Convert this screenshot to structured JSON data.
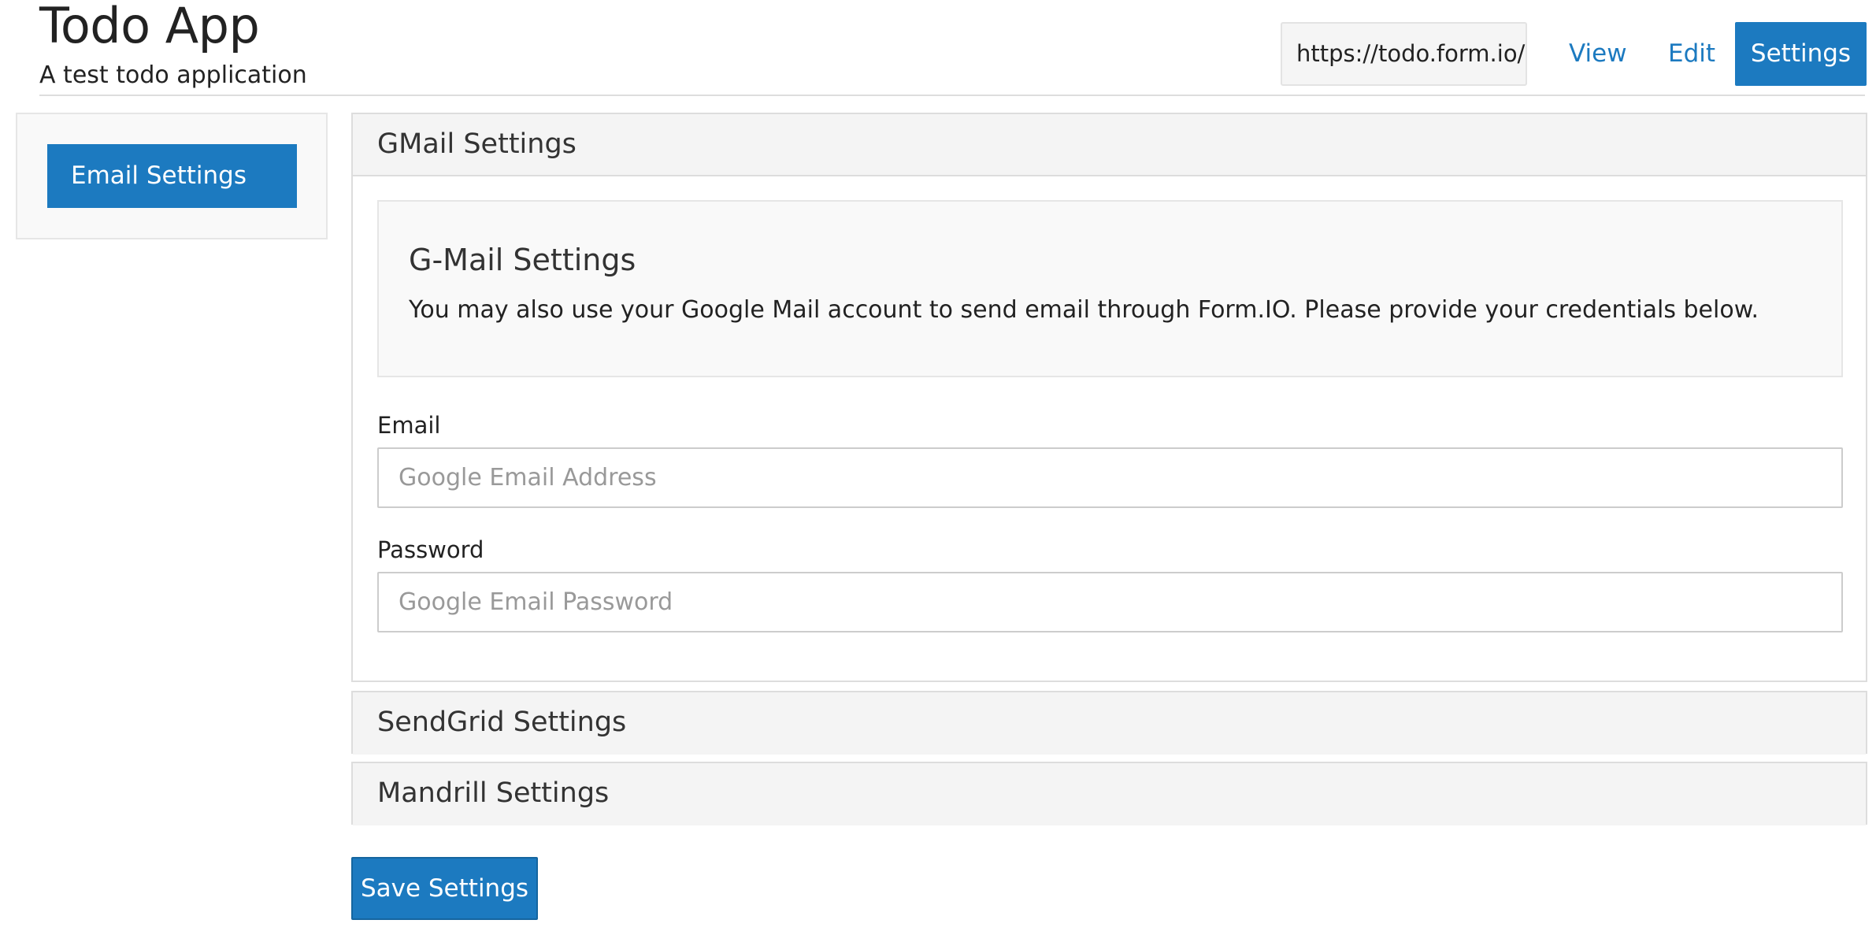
{
  "header": {
    "title": "Todo App",
    "subtitle": "A test todo application",
    "url": "https://todo.form.io/",
    "nav": {
      "view": "View",
      "edit": "Edit",
      "settings": "Settings"
    }
  },
  "sidebar": {
    "items": [
      {
        "label": "Email Settings",
        "active": true
      }
    ]
  },
  "panels": {
    "gmail": {
      "heading": "GMail Settings",
      "well_title": "G-Mail Settings",
      "well_text": "You may also use your Google Mail account to send email through Form.IO. Please provide your credentials below.",
      "email_label": "Email",
      "email_placeholder": "Google Email Address",
      "email_value": "",
      "password_label": "Password",
      "password_placeholder": "Google Email Password",
      "password_value": ""
    },
    "sendgrid": {
      "heading": "SendGrid Settings"
    },
    "mandrill": {
      "heading": "Mandrill Settings"
    }
  },
  "actions": {
    "save_label": "Save Settings"
  },
  "colors": {
    "primary": "#1c7ac0",
    "panel_heading_bg": "#f4f4f4",
    "border": "#dddddd"
  }
}
